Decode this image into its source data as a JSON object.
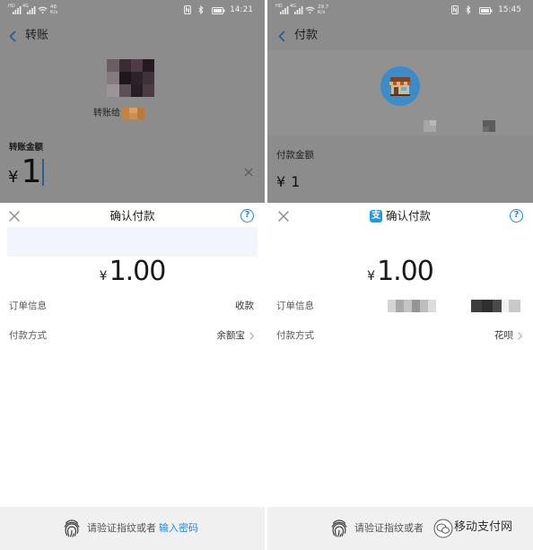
{
  "colors": {
    "accent": "#1b8be3",
    "overlay": "#8c8c8c",
    "sheet_background": "#ffffff",
    "footer_background": "#f0f0f0",
    "alipay_blue": "#1a9be8"
  },
  "icons": {
    "back": "chevron-left-icon",
    "close": "close-icon",
    "help": "help-icon",
    "clear": "clear-icon",
    "row_chevron": "chevron-right-icon",
    "fingerprint": "fingerprint-icon",
    "status": [
      "signal-icon",
      "wifi-icon",
      "nfc-icon",
      "bluetooth-icon",
      "battery-icon"
    ],
    "alipay_logo": "alipay-logo-icon",
    "merchant": "store-icon",
    "watermark": "wechat-icon"
  },
  "left": {
    "status_bar": {
      "signal_1": "HD",
      "signal_2": "4G",
      "speed_value": "48",
      "speed_unit": "K/s",
      "time": "14:21"
    },
    "header": {
      "title": "转账"
    },
    "recipient": {
      "label": "转账给"
    },
    "amount_input": {
      "label": "转账金额",
      "currency": "¥",
      "value": "1"
    },
    "sheet": {
      "title": "确认付款",
      "help_glyph": "?",
      "amount": {
        "currency": "¥",
        "value": "1.00"
      },
      "rows": [
        {
          "label": "订单信息",
          "value": "收款"
        },
        {
          "label": "付款方式",
          "value": "余额宝"
        }
      ]
    },
    "footer": {
      "prompt": "请验证指纹或者",
      "link": "输入密码"
    }
  },
  "right": {
    "status_bar": {
      "signal_1": "HD",
      "signal_2": "4G",
      "speed_value": "29.7",
      "speed_unit": "K/s",
      "time": "15:45"
    },
    "header": {
      "title": "付款"
    },
    "amount_input": {
      "label": "付款金额",
      "currency": "¥",
      "value": "1"
    },
    "sheet": {
      "logo_glyph": "支",
      "title": "确认付款",
      "help_glyph": "?",
      "amount": {
        "currency": "¥",
        "value": "1.00"
      },
      "rows": [
        {
          "label": "订单信息"
        },
        {
          "label": "付款方式",
          "value": "花呗"
        }
      ]
    },
    "footer": {
      "prompt": "请验证指纹或者"
    },
    "watermark": {
      "text": "移动支付网"
    }
  }
}
